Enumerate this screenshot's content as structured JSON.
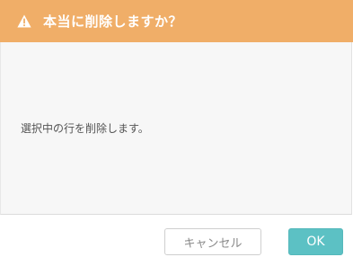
{
  "dialog": {
    "title": "本当に削除しますか？",
    "header_icon": "warning-triangle-icon",
    "message": "選択中の行を削除します。",
    "buttons": {
      "cancel_label": "キャンセル",
      "ok_label": "OK"
    }
  },
  "colors": {
    "header_background": "#f0ae68",
    "ok_button": "#5cc1c4",
    "body_background": "#f7f7f7"
  }
}
